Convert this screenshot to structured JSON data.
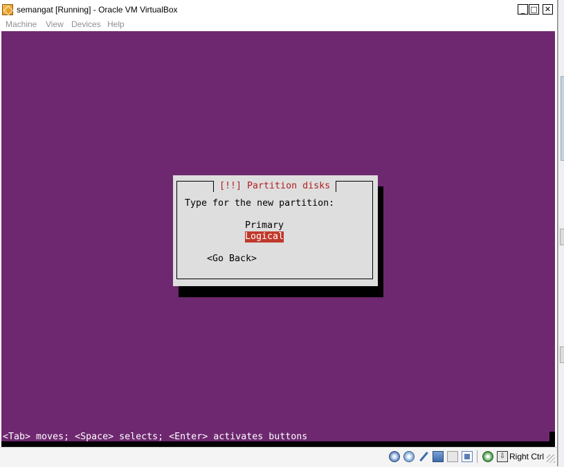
{
  "window": {
    "title": "semangat [Running] - Oracle VM VirtualBox",
    "minimize_glyph": "_",
    "maximize_glyph": "□",
    "close_glyph": "✕"
  },
  "menubar": {
    "items": [
      {
        "label": "Machine"
      },
      {
        "label": "View"
      },
      {
        "label": "Devices"
      },
      {
        "label": "Help"
      }
    ]
  },
  "vm_screen": {
    "background_color": "#6e2870",
    "dialog": {
      "title": "[!!] Partition disks",
      "prompt": "Type for the new partition:",
      "options": [
        {
          "label": "Primary",
          "selected": false
        },
        {
          "label": "Logical",
          "selected": true
        }
      ],
      "back_button": "<Go Back>"
    },
    "status_line": "<Tab> moves; <Space> selects; <Enter> activates buttons"
  },
  "statusbar": {
    "icons": [
      "hard-disk-icon",
      "optical-drive-icon",
      "usb-icon",
      "network-icon",
      "shared-folders-icon",
      "display-icon",
      "mouse-capture-icon",
      "host-key-icon"
    ],
    "host_key_label": "Right Ctrl"
  }
}
